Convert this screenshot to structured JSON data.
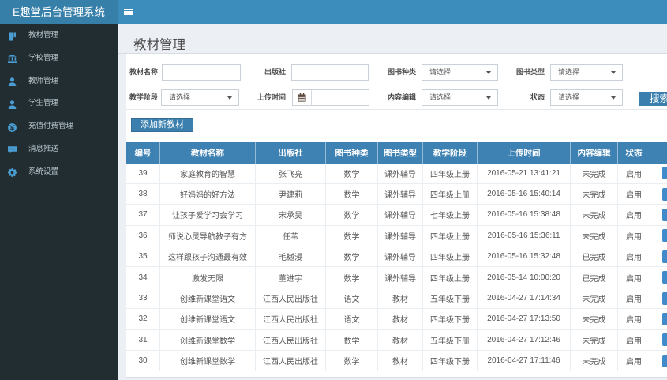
{
  "app": {
    "title": "E趣堂后台管理系统"
  },
  "sidebar": {
    "items": [
      {
        "label": "教材管理",
        "icon": "book"
      },
      {
        "label": "学校管理",
        "icon": "bank"
      },
      {
        "label": "教师管理",
        "icon": "user"
      },
      {
        "label": "学生管理",
        "icon": "user"
      },
      {
        "label": "充值付费管理",
        "icon": "yen-circle"
      },
      {
        "label": "消息推送",
        "icon": "comment"
      },
      {
        "label": "系统设置",
        "icon": "gear"
      }
    ]
  },
  "page": {
    "title": "教材管理"
  },
  "filters": {
    "fields": [
      {
        "label": "教材名称",
        "type": "text",
        "value": ""
      },
      {
        "label": "出版社",
        "type": "text",
        "value": ""
      },
      {
        "label": "图书种类",
        "type": "select",
        "value": "请选择"
      },
      {
        "label": "图书类型",
        "type": "select",
        "value": "请选择"
      },
      {
        "label": "教学阶段",
        "type": "select",
        "value": "请选择"
      },
      {
        "label": "上传时间",
        "type": "date",
        "value": ""
      },
      {
        "label": "内容编辑",
        "type": "select",
        "value": "请选择"
      },
      {
        "label": "状态",
        "type": "select",
        "value": "请选择"
      }
    ],
    "search_label": "搜索"
  },
  "toolbar": {
    "add_label": "添加新教材"
  },
  "table": {
    "columns": [
      "编号",
      "教材名称",
      "出版社",
      "图书种类",
      "图书类型",
      "教学阶段",
      "上传时间",
      "内容编辑",
      "状态",
      ""
    ],
    "rows": [
      [
        "39",
        "家庭教育的智慧",
        "张飞亮",
        "数学",
        "课外辅导",
        "四年级上册",
        "2016-05-21 13:41:21",
        "未完成",
        "启用"
      ],
      [
        "38",
        "好妈妈的好方法",
        "尹建莉",
        "数学",
        "课外辅导",
        "四年级上册",
        "2016-05-16 15:40:14",
        "未完成",
        "启用"
      ],
      [
        "37",
        "让孩子爱学习会学习",
        "宋承昊",
        "数学",
        "课外辅导",
        "七年级上册",
        "2016-05-16 15:38:48",
        "未完成",
        "启用"
      ],
      [
        "36",
        "师说心灵导航教子有方",
        "任苇",
        "数学",
        "课外辅导",
        "四年级上册",
        "2016-05-16 15:36:11",
        "未完成",
        "启用"
      ],
      [
        "35",
        "这样跟孩子沟通最有效",
        "毛樾漫",
        "数学",
        "课外辅导",
        "四年级上册",
        "2016-05-16 15:32:48",
        "已完成",
        "启用"
      ],
      [
        "34",
        "激发无限",
        "董进宇",
        "数学",
        "课外辅导",
        "四年级上册",
        "2016-05-14 10:00:20",
        "已完成",
        "启用"
      ],
      [
        "33",
        "创维新课堂语文",
        "江西人民出版社",
        "语文",
        "教材",
        "五年级下册",
        "2016-04-27 17:14:34",
        "未完成",
        "启用"
      ],
      [
        "32",
        "创维新课堂语文",
        "江西人民出版社",
        "语文",
        "教材",
        "四年级下册",
        "2016-04-27 17:13:50",
        "未完成",
        "启用"
      ],
      [
        "31",
        "创维新课堂数学",
        "江西人民出版社",
        "数学",
        "教材",
        "五年级下册",
        "2016-04-27 17:12:46",
        "未完成",
        "启用"
      ],
      [
        "30",
        "创维新课堂数学",
        "江西人民出版社",
        "数学",
        "教材",
        "四年级下册",
        "2016-04-27 17:11:46",
        "未完成",
        "启用"
      ]
    ]
  }
}
